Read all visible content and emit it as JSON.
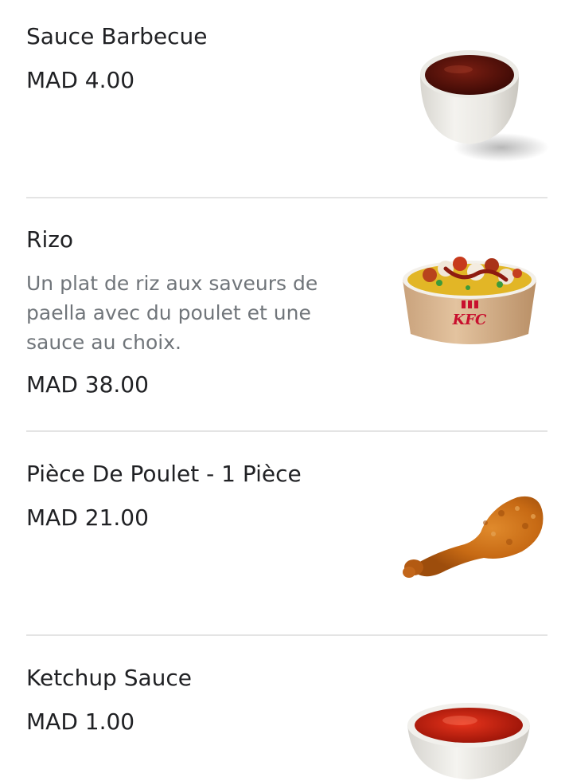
{
  "menu": {
    "items": [
      {
        "name": "Sauce Barbecue",
        "price": "MAD 4.00",
        "image": "barbecue-sauce-cup"
      },
      {
        "name": "Rizo",
        "description": "Un plat de riz aux saveurs de paella avec du poulet et une sauce au choix.",
        "price": "MAD 38.00",
        "image": "rice-bowl",
        "brand": "KFC"
      },
      {
        "name": "Pièce De Poulet - 1 Pièce",
        "price": "MAD 21.00",
        "image": "fried-chicken-drumstick"
      },
      {
        "name": "Ketchup Sauce",
        "price": "MAD 1.00",
        "image": "ketchup-bowl"
      }
    ]
  },
  "colors": {
    "text_primary": "#202124",
    "text_secondary": "#70757a",
    "divider": "#e4e4e4",
    "background": "#ffffff"
  }
}
